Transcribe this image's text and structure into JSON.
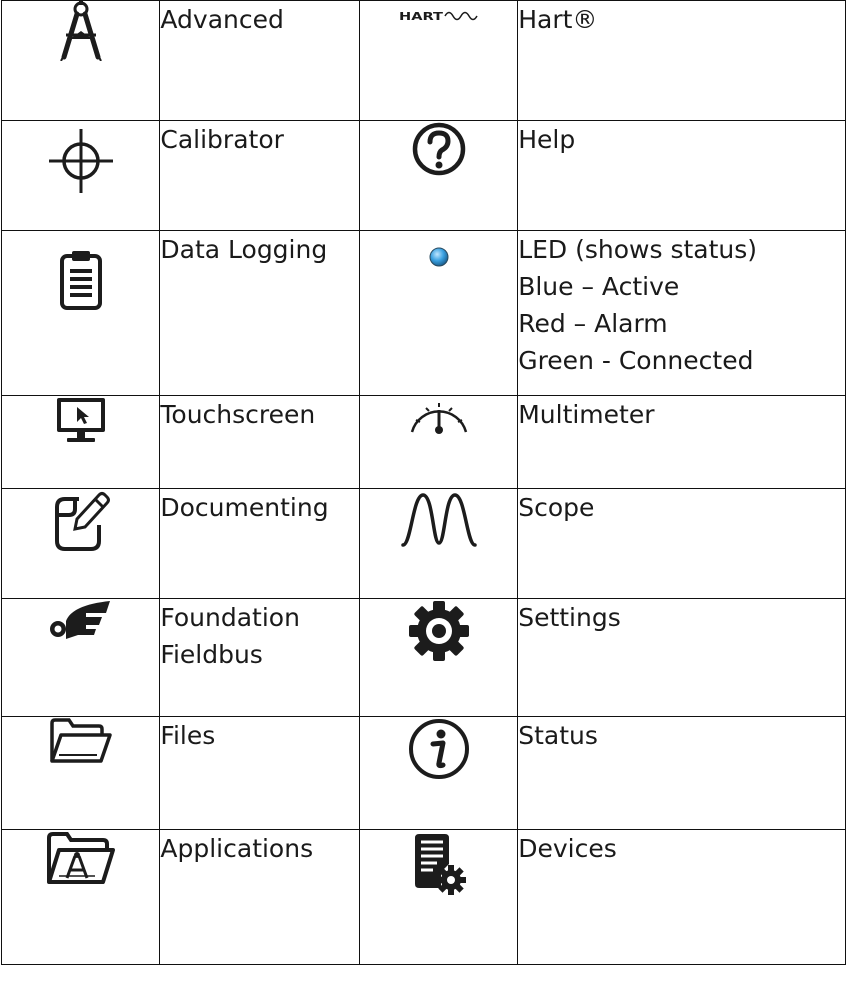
{
  "rows": [
    {
      "left": {
        "icon": "drafting-compass-icon",
        "label": "Advanced"
      },
      "right": {
        "icon": "hart-logo-icon",
        "logo_text": "HART",
        "label": "Hart®"
      }
    },
    {
      "left": {
        "icon": "crosshair-icon",
        "label": "Calibrator"
      },
      "right": {
        "icon": "question-circle-icon",
        "label": "Help"
      }
    },
    {
      "left": {
        "icon": "clipboard-icon",
        "label": "Data Logging"
      },
      "right": {
        "icon": "led-icon",
        "lines": [
          "LED (shows status)",
          "Blue – Active",
          "Red – Alarm",
          "Green - Connected"
        ]
      }
    },
    {
      "left": {
        "icon": "monitor-cursor-icon",
        "label": "Touchscreen"
      },
      "right": {
        "icon": "gauge-icon",
        "label": "Multimeter"
      }
    },
    {
      "left": {
        "icon": "document-pencil-icon",
        "label": "Documenting"
      },
      "right": {
        "icon": "waveform-icon",
        "label": "Scope"
      }
    },
    {
      "left": {
        "icon": "fieldbus-icon",
        "lines": [
          "Foundation",
          "Fieldbus"
        ]
      },
      "right": {
        "icon": "gear-icon",
        "label": "Settings"
      }
    },
    {
      "left": {
        "icon": "folder-icon",
        "label": "Files"
      },
      "right": {
        "icon": "info-circle-icon",
        "label": "Status"
      }
    },
    {
      "left": {
        "icon": "applications-folder-icon",
        "label": "Applications"
      },
      "right": {
        "icon": "device-settings-icon",
        "label": "Devices"
      }
    }
  ],
  "colors": {
    "text": "#1a1a1a",
    "border": "#111111",
    "icon": "#1c1c1c",
    "led_blue": "#3aa0e0"
  }
}
